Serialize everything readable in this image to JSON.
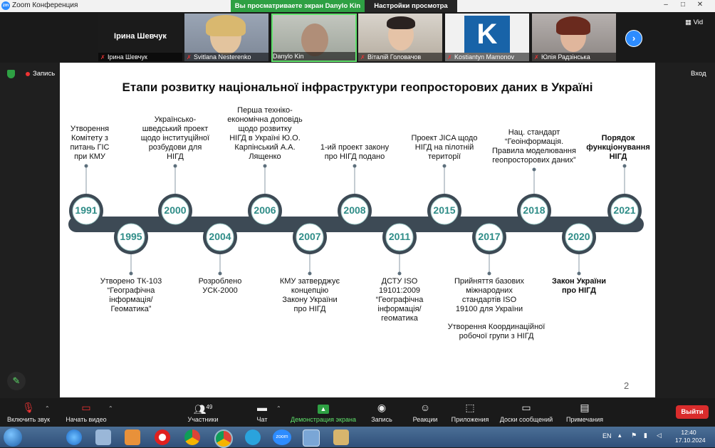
{
  "window": {
    "title": "Zoom Конференция",
    "share_notice": "Вы просматриваете экран Danylo Kin",
    "view_settings": "Настройки просмотра",
    "logo_text": "zm"
  },
  "participants": {
    "featured_name": "Ірина Шевчук",
    "tiles": [
      {
        "name": "Ірина Шевчук"
      },
      {
        "name": "Svitlana Nesterenko"
      },
      {
        "name": "Danylo Kin"
      },
      {
        "name": "Віталій Головачов"
      },
      {
        "name": "Kostiantyn Mamonov"
      },
      {
        "name": "Юлія Радзінська"
      }
    ],
    "k_letter": "K",
    "view_label": "Vid"
  },
  "session": {
    "recording_label": "Запись",
    "exit_label": "Вход"
  },
  "slide": {
    "title": "Етапи розвитку національної інфраструктури геопросторових даних в Україні",
    "page_number": "2",
    "milestones": [
      {
        "year": "1991",
        "lines": [
          "Утворення",
          "Комітету з",
          "питань ГІС",
          "при КМУ"
        ]
      },
      {
        "year": "1995",
        "lines": [
          "Утворено ТК-103",
          "“Географічна",
          "інформація/",
          "Геоматика”"
        ]
      },
      {
        "year": "2000",
        "lines": [
          "Українсько-",
          "шведський проект",
          "щодо інституційної",
          "розбудови для",
          "НІГД"
        ]
      },
      {
        "year": "2004",
        "lines": [
          "Розроблено",
          "УСК-2000"
        ]
      },
      {
        "year": "2006",
        "lines": [
          "Перша техніко-",
          "економічна доповідь",
          "щодо розвитку",
          "НІГД в Україні  Ю.О.",
          "Карпінський А.А.",
          "Лященко"
        ]
      },
      {
        "year": "2007",
        "lines": [
          "КМУ затверджує",
          "концепцію",
          "Закону  України",
          "про НІГД"
        ]
      },
      {
        "year": "2008",
        "lines": [
          "1-ий проект закону",
          "про НІГД подано"
        ]
      },
      {
        "year": "2011",
        "lines": [
          "ДСТУ ISO",
          "19101:2009",
          "“Географічна",
          "інформація/",
          "геоматика"
        ]
      },
      {
        "year": "2015",
        "lines": [
          "Проект JICA щодо",
          "НІГД на пілотній",
          "території"
        ]
      },
      {
        "year": "2017",
        "lines": [
          "Прийняття базових",
          "міжнародних",
          "стандартів ISO",
          "19100 для України"
        ],
        "extra_lines": [
          "Утворення  Координаційної",
          "робочої групи з НІГД"
        ]
      },
      {
        "year": "2018",
        "lines": [
          "Нац. стандарт",
          "“Геоінформація.",
          "Правила моделювання",
          "геопросторових даних”"
        ]
      },
      {
        "year": "2020",
        "lines": [
          "Закон України",
          "про НІГД"
        ]
      },
      {
        "year": "2021",
        "lines": [
          "Порядок",
          "функціонування",
          "НІГД"
        ]
      }
    ]
  },
  "toolbar": {
    "mute": "Включить звук",
    "video": "Начать видео",
    "participants": "Участники",
    "participants_count": "49",
    "chat": "Чат",
    "share": "Демонстрация экрана",
    "record": "Запись",
    "reactions": "Реакции",
    "apps": "Приложения",
    "whiteboard": "Доски сообщений",
    "notes": "Примечания",
    "leave": "Выйти"
  },
  "taskbar": {
    "lang": "EN",
    "time": "12:40",
    "date": "17.10.2024",
    "zoom_label": "zoom"
  },
  "colors": {
    "accent_teal": "#2f8d88",
    "pill_gray": "#3d4a55",
    "share_green": "#2ea043",
    "leave_red": "#d92c2c",
    "zoom_blue": "#2d8cff"
  }
}
